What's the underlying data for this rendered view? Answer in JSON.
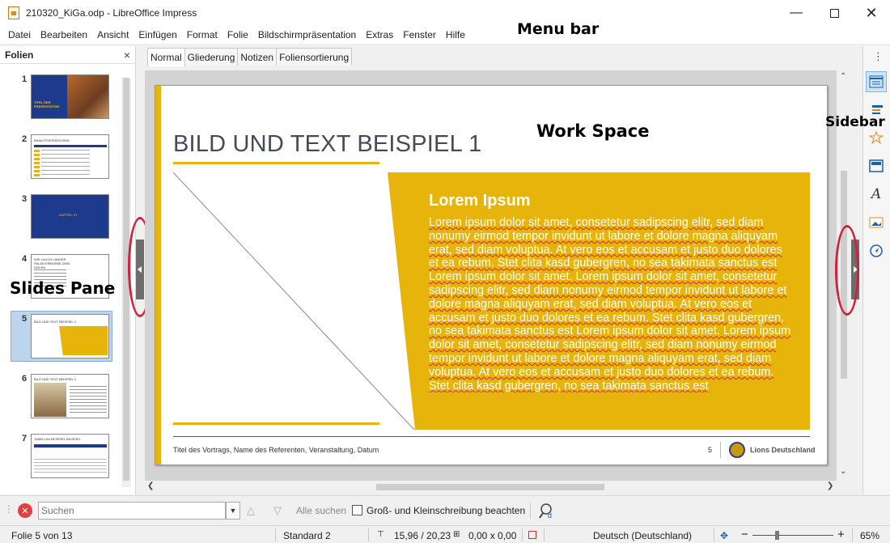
{
  "window": {
    "title": "210320_KiGa.odp - LibreOffice Impress",
    "minimize_icon": "minimize-icon",
    "maximize_icon": "maximize-icon",
    "close_icon": "close-icon"
  },
  "menu": [
    "Datei",
    "Bearbeiten",
    "Ansicht",
    "Einfügen",
    "Format",
    "Folie",
    "Bildschirmpräsentation",
    "Extras",
    "Fenster",
    "Hilfe"
  ],
  "annotations": {
    "menu_bar": "Menu bar",
    "work_space": "Work Space",
    "sidebar": "Sidebar",
    "slides_pane": "Slides Pane"
  },
  "annotation_color": "#d0203a",
  "slides_pane": {
    "title": "Folien",
    "close": "×",
    "slide_numbers": [
      "1",
      "2",
      "3",
      "4",
      "5",
      "6",
      "7"
    ],
    "selected": "5",
    "thumb_texts": {
      "t1": "TITEL DER PRÄSENTATION",
      "t2": "INHALTSVERZEICHNIS",
      "t3": "KAPITEL XY",
      "t4": "WIE LAUCH LÄNDER PALAN ERNGEBE ZWEI ZEILEN",
      "t5": "BILD UND TEXT BEISPIEL 1",
      "t6": "BILD UND TEXT BEISPIEL 2",
      "t7": "TABELLEN BEISPIEL BEISPIEL"
    }
  },
  "view_tabs": [
    "Normal",
    "Gliederung",
    "Notizen",
    "Foliensortierung"
  ],
  "active_tab": "Normal",
  "slide": {
    "heading": "BILD UND TEXT BEISPIEL 1",
    "box_title": "Lorem Ipsum",
    "box_body": "Lorem ipsum dolor sit amet, consetetur sadipscing elitr, sed diam nonumy eirmod tempor invidunt ut labore et dolore magna aliquyam erat, sed diam voluptua. At vero eos et accusam et justo duo dolores et ea rebum. Stet clita kasd gubergren, no sea takimata sanctus est Lorem ipsum dolor sit amet. Lorem ipsum dolor sit amet, consetetur sadipscing elitr, sed diam nonumy eirmod tempor invidunt ut labore et dolore magna aliquyam erat, sed diam voluptua. At vero eos et accusam et justo duo dolores et ea rebum. Stet clita kasd gubergren, no sea takimata sanctus est Lorem ipsum dolor sit amet. Lorem ipsum dolor sit amet, consetetur sadipscing elitr, sed diam nonumy eirmod tempor invidunt ut labore et dolore magna aliquyam erat, sed diam voluptua. At vero eos et accusam et justo duo dolores et ea rebum. Stet clita kasd gubergren, no sea takimata sanctus est",
    "footer_text": "Titel des Vortrags, Name des Referenten, Veranstaltung, Datum",
    "footer_number": "5",
    "logo_text": "Lions Deutschland",
    "accent_color": "#e7b40b",
    "heading_color": "#474b57"
  },
  "sidebar_icons": [
    "properties-icon",
    "slide-transition-icon",
    "animation-icon",
    "master-slides-icon",
    "styles-icon",
    "gallery-icon",
    "navigator-icon"
  ],
  "find_bar": {
    "placeholder": "Suchen",
    "find_all": "Alle suchen",
    "match_case": "Groß- und Kleinschreibung beachten"
  },
  "status": {
    "slide_of": "Folie 5 von 13",
    "master": "Standard 2",
    "position": "15,96 / 20,23",
    "size": "0,00 x 0,00",
    "language": "Deutsch (Deutschland)",
    "zoom": "65%",
    "zoom_minus": "−",
    "zoom_plus": "+"
  }
}
